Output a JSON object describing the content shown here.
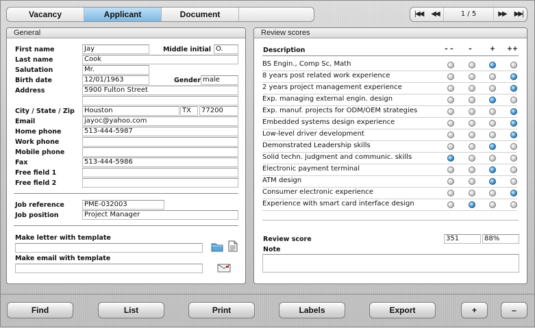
{
  "tabs": {
    "vacancy": "Vacancy",
    "applicant": "Applicant",
    "document": "Document"
  },
  "navigator": {
    "record": "1 / 5"
  },
  "general": {
    "title": "General",
    "labels": {
      "first_name": "First name",
      "middle_initial": "Middle initial",
      "last_name": "Last name",
      "salutation": "Salutation",
      "birth_date": "Birth date",
      "gender": "Gender",
      "address": "Address",
      "city_state_zip": "City / State / Zip",
      "email": "Email",
      "home_phone": "Home phone",
      "work_phone": "Work phone",
      "mobile_phone": "Mobile phone",
      "fax": "Fax",
      "free_field_1": "Free field 1",
      "free_field_2": "Free field 2",
      "job_reference": "Job reference",
      "job_position": "Job position",
      "letter_template": "Make letter with template",
      "email_template": "Make email with template"
    },
    "values": {
      "first_name": "Jay",
      "middle_initial": "O.",
      "last_name": "Cook",
      "salutation": "Mr.",
      "birth_date": "12/01/1963",
      "gender": "male",
      "address": "5900 Fulton Street",
      "address2": "",
      "city": "Houston",
      "state": "TX",
      "zip": "77200",
      "email": "jayoc@yahoo.com",
      "home_phone": "513-444-5987",
      "work_phone": "",
      "mobile_phone": "",
      "fax": "513-444-5986",
      "free_field_1": "",
      "free_field_2": "",
      "job_reference": "PME-032003",
      "job_position": "Project Manager",
      "letter_template": "",
      "email_template": ""
    },
    "icons": {
      "folder": "folder-icon",
      "document": "document-icon",
      "email": "email-icon"
    }
  },
  "review": {
    "title": "Review scores",
    "headers": {
      "description": "Description",
      "mm": "– –",
      "m": "–",
      "p": "+",
      "pp": "++"
    },
    "rows": [
      {
        "desc": "BS Engin., Comp Sc, Math",
        "sel": 2
      },
      {
        "desc": "8 years post related work experience",
        "sel": 3
      },
      {
        "desc": "2 years project management experience",
        "sel": 3
      },
      {
        "desc": "Exp. managing external engin. design",
        "sel": 2
      },
      {
        "desc": "Exp. manuf. projects for ODM/OEM strategies",
        "sel": 3
      },
      {
        "desc": "Embedded systems design experience",
        "sel": 3
      },
      {
        "desc": "Low-level driver development",
        "sel": 3
      },
      {
        "desc": "Demonstrated Leadership skills",
        "sel": 2
      },
      {
        "desc": "Solid techn. judgment and communic. skills",
        "sel": 0
      },
      {
        "desc": "Electronic payment terminal",
        "sel": 2
      },
      {
        "desc": "ATM design",
        "sel": 2
      },
      {
        "desc": "Consumer electronic experience",
        "sel": 3
      },
      {
        "desc": "Experience with smart card interface design",
        "sel": 1
      }
    ],
    "score_label": "Review score",
    "score": "351",
    "percent": "88%",
    "note_label": "Note",
    "note": ""
  },
  "buttons": {
    "find": "Find",
    "list": "List",
    "print": "Print",
    "labels": "Labels",
    "export": "Export",
    "add": "+",
    "remove": "–"
  }
}
